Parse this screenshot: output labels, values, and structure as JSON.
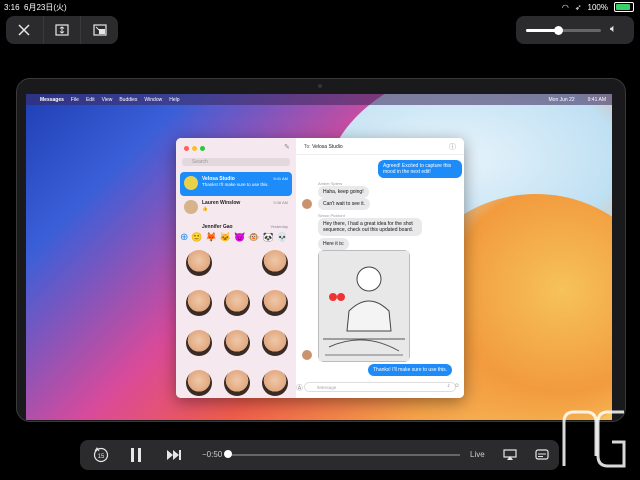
{
  "status_bar": {
    "time": "3:16",
    "date": "6月23日(火)",
    "battery": "100%"
  },
  "mac_menubar": {
    "app": "Messages",
    "items": [
      "File",
      "Edit",
      "View",
      "Buddies",
      "Window",
      "Help"
    ],
    "date": "Mon Jun 22",
    "time": "9:41 AM"
  },
  "messages": {
    "search_placeholder": "Search",
    "to_label": "To:",
    "to_value": "Velosa Studio",
    "conversations": [
      {
        "name": "Velosa Studio",
        "time": "9:41 AM",
        "preview": "Thanks! I'll make sure to use this."
      },
      {
        "name": "Lauren Winslow",
        "time": "9:38 AM",
        "preview": "👍"
      },
      {
        "name": "Jennifer Gao",
        "time": "Yesterday",
        "preview": ""
      }
    ],
    "thread": [
      {
        "dir": "out",
        "text": "Agreed! Excited to capture this mood in the next edit!"
      },
      {
        "dir": "in",
        "sender": "Amber Spiers",
        "text": "Haha, keep going!"
      },
      {
        "dir": "in",
        "text": "Can't wait to see it."
      },
      {
        "dir": "in",
        "sender": "Simon Pickford",
        "text": "Hey there, I had a great idea for the shot sequence, check out this updated board."
      },
      {
        "dir": "in",
        "text": "Here it is:"
      },
      {
        "dir": "out",
        "text": "Thanks! I'll make sure to use this."
      }
    ],
    "composer_placeholder": "iMessage"
  },
  "player": {
    "time_remaining": "−0:50",
    "live_label": "Live",
    "skip_back": "15",
    "progress": 0.0
  }
}
